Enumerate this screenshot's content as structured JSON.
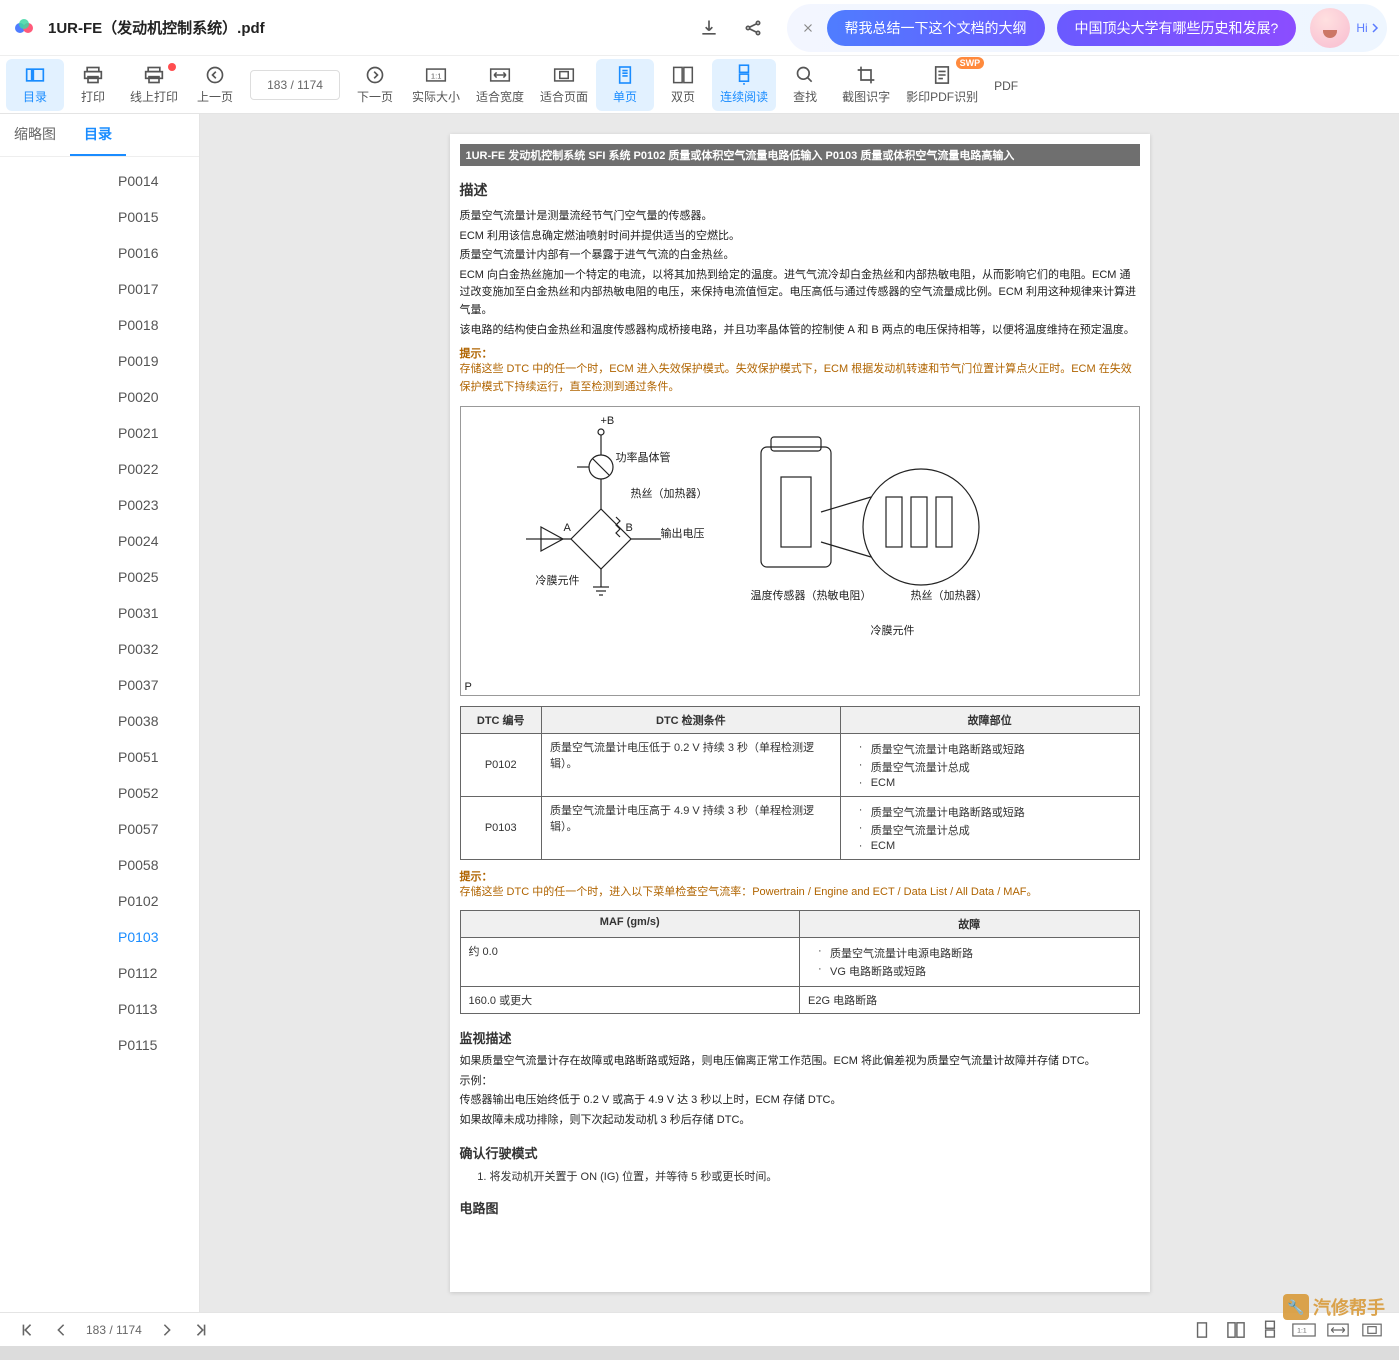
{
  "title": "1UR-FE（发动机控制系统）.pdf",
  "ai": {
    "pill1": "帮我总结一下这个文档的大纲",
    "pill2": "中国顶尖大学有哪些历史和发展?",
    "hi": "Hi"
  },
  "toolbar": {
    "toc": "目录",
    "print": "打印",
    "onlinePrint": "线上打印",
    "prev": "上一页",
    "pagebox": "183 / 1174",
    "next": "下一页",
    "actual": "实际大小",
    "fitw": "适合宽度",
    "fitp": "适合页面",
    "single": "单页",
    "double": "双页",
    "continuous": "连续阅读",
    "find": "查找",
    "ocr": "截图识字",
    "scanpdf": "影印PDF识别",
    "swp": "SWP",
    "pdf": "PDF"
  },
  "sideTabs": {
    "thumb": "缩略图",
    "toc": "目录"
  },
  "toc": [
    "P0014",
    "P0015",
    "P0016",
    "P0017",
    "P0018",
    "P0019",
    "P0020",
    "P0021",
    "P0022",
    "P0023",
    "P0024",
    "P0025",
    "P0031",
    "P0032",
    "P0037",
    "P0038",
    "P0051",
    "P0052",
    "P0057",
    "P0058",
    "P0102",
    "P0103",
    "P0112",
    "P0113",
    "P0115"
  ],
  "tocSelected": "P0103",
  "doc": {
    "header": "1UR-FE 发动机控制系统  SFI 系统  P0102  质量或体积空气流量电路低输入  P0103  质量或体积空气流量电路高输入",
    "h_desc": "描述",
    "p1": "质量空气流量计是测量流经节气门空气量的传感器。",
    "p2": "ECM 利用该信息确定燃油喷射时间并提供适当的空燃比。",
    "p3": "质量空气流量计内部有一个暴露于进气气流的白金热丝。",
    "p4": "ECM 向白金热丝施加一个特定的电流，以将其加热到给定的温度。进气气流冷却白金热丝和内部热敏电阻，从而影响它们的电阻。ECM 通过改变施加至白金热丝和内部热敏电阻的电压，来保持电流值恒定。电压高低与通过传感器的空气流量成比例。ECM 利用这种规律来计算进气量。",
    "p5": "该电路的结构使白金热丝和温度传感器构成桥接电路，并且功率晶体管的控制使 A 和 B 两点的电压保持相等，以便将温度维持在预定温度。",
    "hint1_label": "提示：",
    "hint1_text": "存储这些 DTC 中的任一个时，ECM 进入失效保护模式。失效保护模式下，ECM 根据发动机转速和节气门位置计算点火正时。ECM 在失效保护模式下持续运行，直至检测到通过条件。",
    "fig": {
      "plusB": "+B",
      "power": "功率晶体管",
      "heaterL": "热丝（加热器）",
      "vout": "输出电压",
      "coldL": "冷膜元件",
      "coldR": "冷膜元件",
      "tempSensor": "温度传感器（热敏电阻）",
      "heaterR": "热丝（加热器）",
      "A": "A",
      "B": "B",
      "P": "P"
    },
    "t1": {
      "hdr": [
        "DTC 编号",
        "DTC 检测条件",
        "故障部位"
      ],
      "rows": [
        {
          "code": "P0102",
          "cond": "质量空气流量计电压低于 0.2 V 持续 3 秒（单程检测逻辑）。",
          "faults": [
            "质量空气流量计电路断路或短路",
            "质量空气流量计总成",
            "ECM"
          ]
        },
        {
          "code": "P0103",
          "cond": "质量空气流量计电压高于 4.9 V 持续 3 秒（单程检测逻辑）。",
          "faults": [
            "质量空气流量计电路断路或短路",
            "质量空气流量计总成",
            "ECM"
          ]
        }
      ]
    },
    "hint2_label": "提示：",
    "hint2_text": "存储这些 DTC 中的任一个时，进入以下菜单检查空气流率：Powertrain / Engine and ECT / Data List / All Data / MAF。",
    "t2": {
      "hdr": [
        "MAF (gm/s)",
        "故障"
      ],
      "rows": [
        {
          "maf": "约 0.0",
          "faults": [
            "质量空气流量计电源电路断路",
            "VG 电路断路或短路"
          ]
        },
        {
          "maf": "160.0 或更大",
          "fault": "E2G 电路断路"
        }
      ]
    },
    "h_monitor": "监视描述",
    "m1": "如果质量空气流量计存在故障或电路断路或短路，则电压偏离正常工作范围。ECM 将此偏差视为质量空气流量计故障并存储 DTC。",
    "m2": "示例：",
    "m3": "传感器输出电压始终低于 0.2 V 或高于 4.9 V 达 3 秒以上时，ECM 存储 DTC。",
    "m4": "如果故障未成功排除，则下次起动发动机 3 秒后存储 DTC。",
    "h_confirm": "确认行驶模式",
    "c1": "将发动机开关置于 ON (IG) 位置，并等待 5 秒或更长时间。",
    "h_circuit": "电路图"
  },
  "footer": {
    "page": "183 / 1174"
  },
  "watermark": "汽修帮手"
}
